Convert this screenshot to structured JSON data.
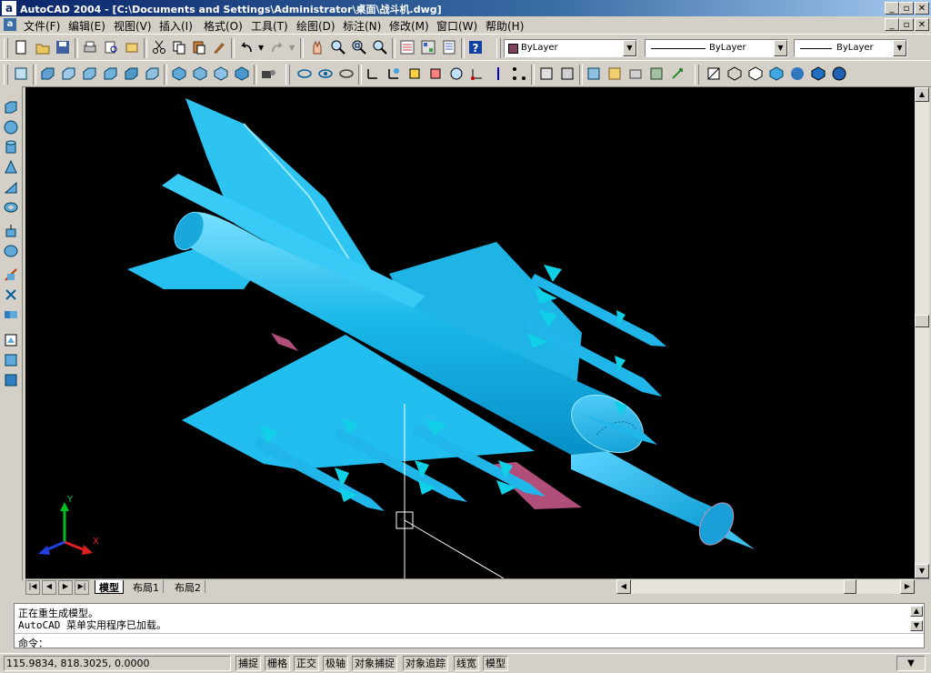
{
  "window": {
    "app_icon": "a",
    "title": "AutoCAD 2004 - [C:\\Documents and Settings\\Administrator\\桌面\\战斗机.dwg]",
    "btn_min": "_",
    "btn_max": "▫",
    "btn_close": "✕"
  },
  "menu": [
    "文件(F)",
    "编辑(E)",
    "视图(V)",
    "插入(I)",
    "格式(O)",
    "工具(T)",
    "绘图(D)",
    "标注(N)",
    "修改(M)",
    "窗口(W)",
    "帮助(H)"
  ],
  "properties": {
    "layer_color": "ByLayer",
    "linetype": "ByLayer",
    "lineweight": "ByLayer"
  },
  "tabs": [
    "模型",
    "布局1",
    "布局2"
  ],
  "command": {
    "history": [
      "正在重生成模型。",
      "AutoCAD 菜单实用程序已加载。"
    ],
    "prompt": "命令："
  },
  "status": {
    "coords": "115.9834,  818.3025, 0.0000",
    "toggles": [
      "捕捉",
      "栅格",
      "正交",
      "极轴",
      "对象捕捉",
      "对象追踪",
      "线宽",
      "模型"
    ]
  },
  "ucs": {
    "y": "Y",
    "x": "X"
  },
  "colors": {
    "model": "#1ab8e8",
    "missile_fin": "#0fd0e6",
    "intake": "#b0507a",
    "background": "#000000"
  }
}
